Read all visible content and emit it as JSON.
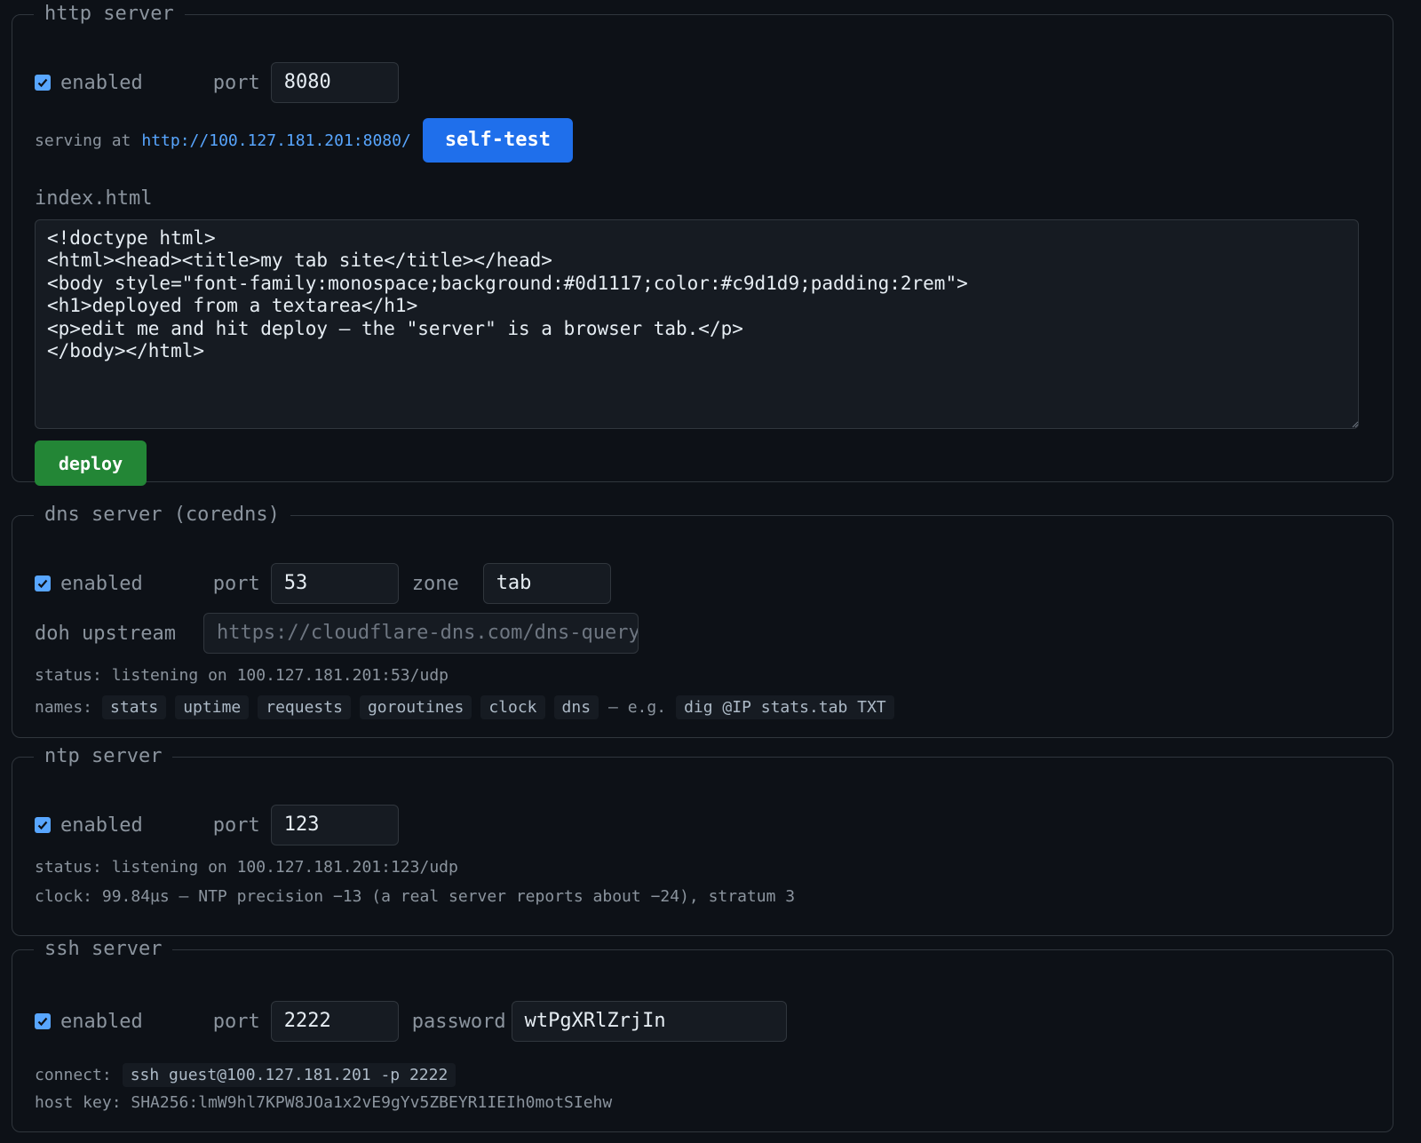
{
  "http": {
    "legend": "http server",
    "enabled_label": "enabled",
    "port_label": "port",
    "port_value": "8080",
    "serving_prefix": "serving at",
    "serving_url": "http://100.127.181.201:8080/",
    "selftest_label": "self-test",
    "file_label": "index.html",
    "html_source": "<!doctype html>\n<html><head><title>my tab site</title></head>\n<body style=\"font-family:monospace;background:#0d1117;color:#c9d1d9;padding:2rem\">\n<h1>deployed from a textarea</h1>\n<p>edit me and hit deploy — the \"server\" is a browser tab.</p>\n</body></html>",
    "deploy_label": "deploy"
  },
  "dns": {
    "legend": "dns server (coredns)",
    "enabled_label": "enabled",
    "port_label": "port",
    "port_value": "53",
    "zone_label": "zone",
    "zone_value": "tab",
    "doh_label": "doh upstream",
    "doh_placeholder": "https://cloudflare-dns.com/dns-query",
    "status_text": "status: listening on 100.127.181.201:53/udp",
    "names_label": "names:",
    "names": [
      "stats",
      "uptime",
      "requests",
      "goroutines",
      "clock",
      "dns"
    ],
    "eg_text": "— e.g.",
    "example_cmd": "dig @IP stats.tab TXT"
  },
  "ntp": {
    "legend": "ntp server",
    "enabled_label": "enabled",
    "port_label": "port",
    "port_value": "123",
    "status_text": "status: listening on 100.127.181.201:123/udp",
    "clock_text": "clock: 99.84µs — NTP precision −13 (a real server reports about −24), stratum 3"
  },
  "ssh": {
    "legend": "ssh server",
    "enabled_label": "enabled",
    "port_label": "port",
    "port_value": "2222",
    "password_label": "password",
    "password_value": "wtPgXRlZrjIn",
    "connect_label": "connect:",
    "connect_cmd": "ssh guest@100.127.181.201 -p 2222",
    "hostkey_text": "host key: SHA256:lmW9hl7KPW8JOa1x2vE9gYv5ZBEYR1IEIh0motSIehw"
  },
  "colors": {
    "background": "#0d1117",
    "accent_blue": "#1f6feb",
    "accent_green": "#238636",
    "link": "#58a6ff"
  }
}
